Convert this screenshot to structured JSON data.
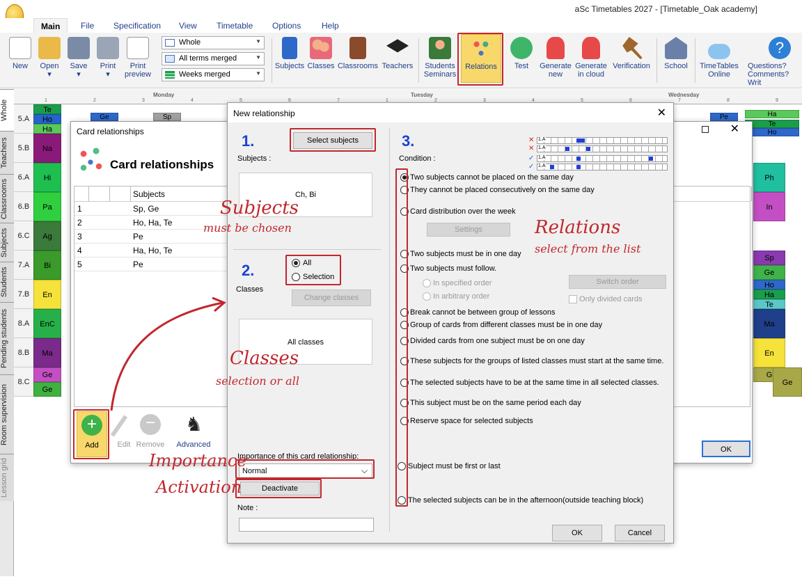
{
  "app": {
    "title": "aSc Timetables 2027  - [Timetable_Oak academy]"
  },
  "menu": [
    "Main",
    "File",
    "Specification",
    "View",
    "Timetable",
    "Options",
    "Help"
  ],
  "ribbon": {
    "left": [
      {
        "key": "new",
        "label": "New"
      },
      {
        "key": "open",
        "label": "Open"
      },
      {
        "key": "save",
        "label": "Save"
      },
      {
        "key": "print",
        "label": "Print"
      },
      {
        "key": "print_preview",
        "label": "Print\npreview"
      }
    ],
    "selects": [
      "Whole",
      "All terms merged",
      "Weeks merged"
    ],
    "mid": [
      {
        "key": "subjects",
        "label": "Subjects"
      },
      {
        "key": "classes",
        "label": "Classes"
      },
      {
        "key": "classrooms",
        "label": "Classrooms"
      },
      {
        "key": "teachers",
        "label": "Teachers"
      },
      {
        "key": "students",
        "label": "Students\nSeminars"
      },
      {
        "key": "relations",
        "label": "Relations"
      },
      {
        "key": "test",
        "label": "Test"
      },
      {
        "key": "generate_new",
        "label": "Generate\nnew"
      },
      {
        "key": "generate_cloud",
        "label": "Generate\nin cloud"
      },
      {
        "key": "verification",
        "label": "Verification"
      },
      {
        "key": "school",
        "label": "School"
      },
      {
        "key": "online",
        "label": "TimeTables\nOnline"
      },
      {
        "key": "questions",
        "label": "Questions?\nComments? Writ"
      }
    ]
  },
  "side_tabs": [
    "Whole",
    "Teachers",
    "Classrooms",
    "Subjects",
    "Students",
    "Pending students",
    "Room supervision",
    "Lesson grid"
  ],
  "grid": {
    "days": [
      "Monday",
      "Tuesday",
      "Wednesday"
    ],
    "periods": [
      "1",
      "2",
      "3",
      "4",
      "5",
      "6",
      "7",
      "1",
      "2",
      "3",
      "4",
      "5",
      "6",
      "7",
      "8",
      "9"
    ],
    "rows": [
      "5.A",
      "5.B",
      "6.A",
      "6.B",
      "6.C",
      "7.A",
      "7.B",
      "8.A",
      "8.B",
      "8.C"
    ],
    "left_cells": [
      {
        "row": 0,
        "text": "Te",
        "color": "#1a9e4b"
      },
      {
        "row": 0,
        "text": "Ho",
        "color": "#2563c9"
      },
      {
        "row": 0,
        "text": "Ha",
        "color": "#5ac85a"
      },
      {
        "row": 1,
        "text": "Na",
        "color": "#8a1a7a"
      },
      {
        "row": 2,
        "text": "Hi",
        "color": "#1fbf4f"
      },
      {
        "row": 3,
        "text": "Pa",
        "color": "#2fcf3f"
      },
      {
        "row": 4,
        "text": "Ag",
        "color": "#3a7a3a"
      },
      {
        "row": 5,
        "text": "Bi",
        "color": "#3a9a2a"
      },
      {
        "row": 6,
        "text": "En",
        "color": "#f5e23a"
      },
      {
        "row": 7,
        "text": "EnC",
        "color": "#27b04a"
      },
      {
        "row": 8,
        "text": "Ma",
        "color": "#7a2a8a"
      },
      {
        "row": 9,
        "text": "Ge",
        "color": "#c44fc4"
      },
      {
        "row": 9,
        "text": "Ge",
        "color": "#40b040"
      }
    ],
    "top_cells": [
      {
        "text": "Ge"
      },
      {
        "text": "Sp"
      },
      {
        "text": "Pe"
      },
      {
        "text": "Ha"
      },
      {
        "text": "Te"
      },
      {
        "text": "Ho"
      }
    ],
    "right_cells": [
      {
        "row": 2,
        "text": "Ph"
      },
      {
        "row": 3,
        "text": "In"
      },
      {
        "row": 5,
        "text": "Sp"
      },
      {
        "row": 5,
        "text": "Ge"
      },
      {
        "row": 6,
        "text": "Ho"
      },
      {
        "row": 6,
        "text": "Ha"
      },
      {
        "row": 6,
        "text": "Te"
      },
      {
        "row": 7,
        "text": "Ma"
      },
      {
        "row": 8,
        "text": "En"
      },
      {
        "row": 9,
        "text": "G"
      },
      {
        "row": 9,
        "text": "Ge"
      }
    ]
  },
  "card_dialog": {
    "title": "Card relationships",
    "heading": "Card relationships",
    "col_subjects": "Subjects",
    "rows": [
      {
        "n": "1",
        "s": "Sp, Ge"
      },
      {
        "n": "2",
        "s": "Ho, Ha, Te"
      },
      {
        "n": "3",
        "s": "Pe"
      },
      {
        "n": "4",
        "s": "Ha, Ho, Te"
      },
      {
        "n": "5",
        "s": "Pe"
      }
    ],
    "buttons": {
      "add": "Add",
      "edit": "Edit",
      "remove": "Remove",
      "advanced": "Advanced"
    },
    "ok": "OK"
  },
  "dialog": {
    "title": "New relationship",
    "step1": "1.",
    "step2": "2.",
    "step3": "3.",
    "select_subjects": "Select subjects",
    "subjects_label": "Subjects :",
    "subjects_value": "Ch, Bi",
    "classes_label": "Classes",
    "radio_all": "All",
    "radio_selection": "Selection",
    "change_classes": "Change classes",
    "classes_value": "All classes",
    "importance_label": "Importance of this card relationship:",
    "importance_value": "Normal",
    "deactivate": "Deactivate",
    "note_label": "Note :",
    "condition_label": "Condition :",
    "conditions": [
      "Two subjects cannot be placed on the same day",
      "They cannot be placed consecutively on the same day",
      "Card distribution over the week",
      "Two subjects must be in one day",
      "Two subjects must follow.",
      "Break cannot be between group of lessons",
      "Group of cards from different classes must be in one day",
      "Divided cards from one subject must be on one day",
      "These subjects for the groups of listed classes must start at the same time.",
      "The selected subjects have to be at the same time in all selected classes.",
      "This subject must be on the same period each day",
      "Reserve space for selected subjects",
      "Subject must be first or last",
      "The selected subjects can be in the afternoon(outside teaching block)"
    ],
    "settings": "Settings",
    "in_specified_order": "In specified order",
    "in_arbitrary_order": "In arbitrary order",
    "switch_order": "Switch order",
    "only_divided": "Only divided cards",
    "ok": "OK",
    "cancel": "Cancel",
    "preview_label": "1.A"
  },
  "annotations": {
    "subjects": "Subjects",
    "subjects_sub": "must be chosen",
    "relations": "Relations",
    "relations_sub": "select from the list",
    "classes": "Classes",
    "classes_sub": "selection or all",
    "importance": "Importance",
    "activation": "Activation"
  },
  "colors": {
    "accent": "#c1272d",
    "highlight": "#f8d86a",
    "link": "#1f3f8a"
  }
}
